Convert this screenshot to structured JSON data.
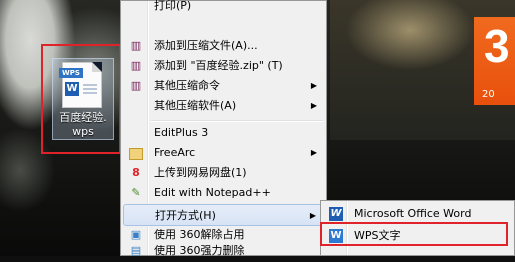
{
  "desktop": {
    "file_icon": {
      "badge": "WPS",
      "letter": "W",
      "label_line1": "百度经验.",
      "label_line2": "wps"
    },
    "tile": {
      "number": "3",
      "caption": "20"
    }
  },
  "menu": {
    "items": [
      {
        "label": "打印(P)",
        "icon": "print-icon",
        "submenu": false
      },
      {
        "label": "添加到压缩文件(A)...",
        "icon": "winrar-books-icon",
        "submenu": false
      },
      {
        "label": "添加到 \"百度经验.zip\" (T)",
        "icon": "winrar-books-icon",
        "submenu": false
      },
      {
        "label": "其他压缩命令",
        "icon": "winrar-books-icon",
        "submenu": true
      },
      {
        "label": "其他压缩软件(A)",
        "icon": "",
        "submenu": true
      },
      {
        "label": "EditPlus 3",
        "icon": "",
        "submenu": false
      },
      {
        "label": "FreeArc",
        "icon": "freearc-icon",
        "submenu": true
      },
      {
        "label": "上传到网易网盘(1)",
        "icon": "netease-cloud-icon",
        "submenu": false
      },
      {
        "label": "Edit with Notepad++",
        "icon": "notepad-plus-plus-icon",
        "submenu": false
      },
      {
        "label": "打开方式(H)",
        "icon": "",
        "submenu": true
      },
      {
        "label": "使用 360解除占用",
        "icon": "360-unlock-icon",
        "submenu": false
      },
      {
        "label": "使用 360强力删除",
        "icon": "360-shred-icon",
        "submenu": false
      }
    ]
  },
  "submenu": {
    "items": [
      {
        "label": "Microsoft Office Word",
        "icon_glyph": "W",
        "icon": "word-icon"
      },
      {
        "label": "WPS文字",
        "icon_glyph": "W",
        "icon": "wps-writer-icon"
      }
    ]
  },
  "colors": {
    "highlight_box": "#e0232a",
    "menu_bg": "#f0f0f0",
    "tile": "#f06a1e"
  }
}
